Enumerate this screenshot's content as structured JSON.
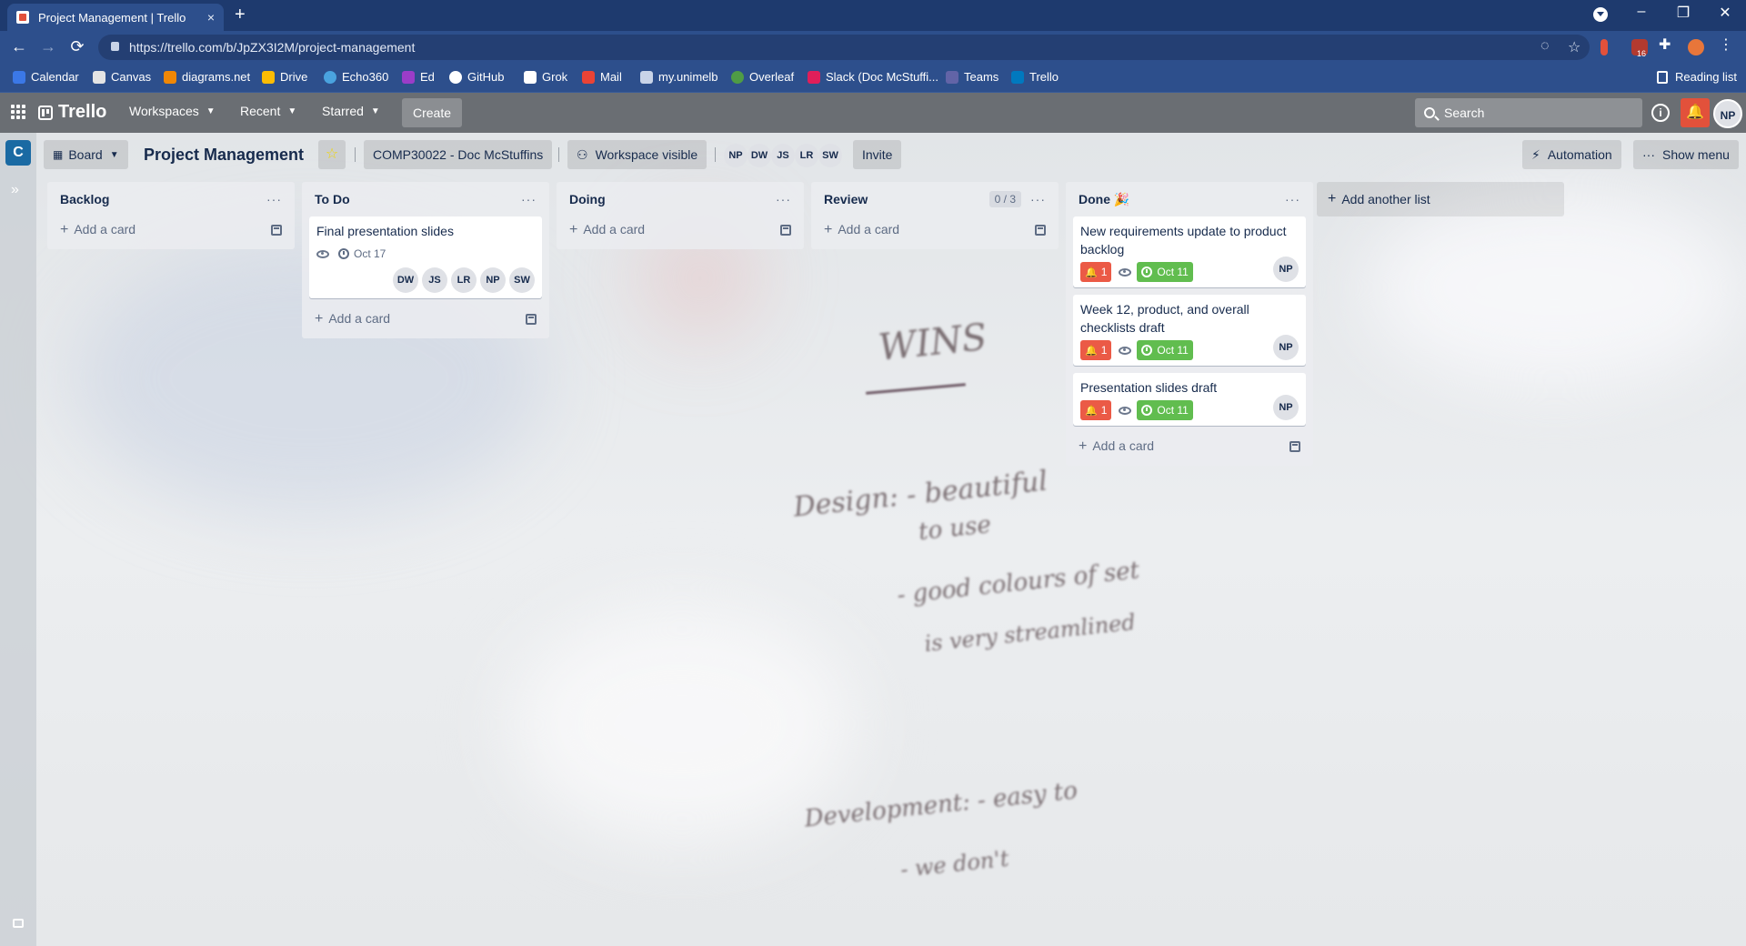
{
  "browser": {
    "tab_title": "Project Management | Trello",
    "tab_close": "×",
    "new_tab": "+",
    "url": "https://trello.com/b/JpZX3I2M/project-management",
    "window_controls": [
      "–",
      "❐",
      "✕"
    ],
    "extension_badge": "16"
  },
  "bookmarks": [
    {
      "label": "Calendar",
      "color": "#3b78e7"
    },
    {
      "label": "Canvas",
      "color": "#e4e4e4"
    },
    {
      "label": "diagrams.net",
      "color": "#f08705"
    },
    {
      "label": "Drive",
      "color": "#fbbc04"
    },
    {
      "label": "Echo360",
      "color": "#4aa3df"
    },
    {
      "label": "Ed",
      "color": "#9b3dc8"
    },
    {
      "label": "GitHub",
      "color": "#ffffff"
    },
    {
      "label": "Grok",
      "color": "#ffffff"
    },
    {
      "label": "Mail",
      "color": "#ea4335"
    },
    {
      "label": "my.unimelb",
      "color": "#c9d4e8"
    },
    {
      "label": "Overleaf",
      "color": "#4f9c45"
    },
    {
      "label": "Slack (Doc McStuffi...",
      "color": "#e01e5a"
    },
    {
      "label": "Teams",
      "color": "#6264a7"
    },
    {
      "label": "Trello",
      "color": "#0079bf"
    }
  ],
  "reading_list": "Reading list",
  "header": {
    "logo": "Trello",
    "menus": [
      "Workspaces",
      "Recent",
      "Starred"
    ],
    "create": "Create",
    "search_placeholder": "Search",
    "user_initials": "NP"
  },
  "sidebar": {
    "workspace_initial": "C",
    "expand": "»"
  },
  "board": {
    "view": "Board",
    "title": "Project Management",
    "workspace": "COMP30022 - Doc McStuffins",
    "visibility": "Workspace visible",
    "members": [
      "NP",
      "DW",
      "JS",
      "LR",
      "SW"
    ],
    "invite": "Invite",
    "automation": "Automation",
    "show_menu": "Show menu"
  },
  "lists": [
    {
      "name": "Backlog",
      "add_card": "Add a card",
      "cards": []
    },
    {
      "name": "To Do",
      "add_card": "Add a card",
      "cards": [
        {
          "title": "Final presentation slides",
          "due": "Oct 17",
          "members": [
            "DW",
            "JS",
            "LR",
            "NP",
            "SW"
          ]
        }
      ]
    },
    {
      "name": "Doing",
      "add_card": "Add a card",
      "cards": []
    },
    {
      "name": "Review",
      "wip_limit": "0 / 3",
      "add_card": "Add a card",
      "cards": []
    },
    {
      "name": "Done 🎉",
      "add_card": "Add a card",
      "cards": [
        {
          "title": "New requirements update to product backlog",
          "notifications": "1",
          "due": "Oct 11",
          "member": "NP"
        },
        {
          "title": "Week 12, product, and overall checklists draft",
          "notifications": "1",
          "due": "Oct 11",
          "member": "NP"
        },
        {
          "title": "Presentation slides draft",
          "notifications": "1",
          "due": "Oct 11",
          "member": "NP"
        }
      ]
    }
  ],
  "add_list": "Add another list",
  "list_menu": "···",
  "colors": {
    "notification_badge": "#eb5a46",
    "due_complete": "#61bd4f",
    "workspace_badge": "#1a6aa3"
  }
}
